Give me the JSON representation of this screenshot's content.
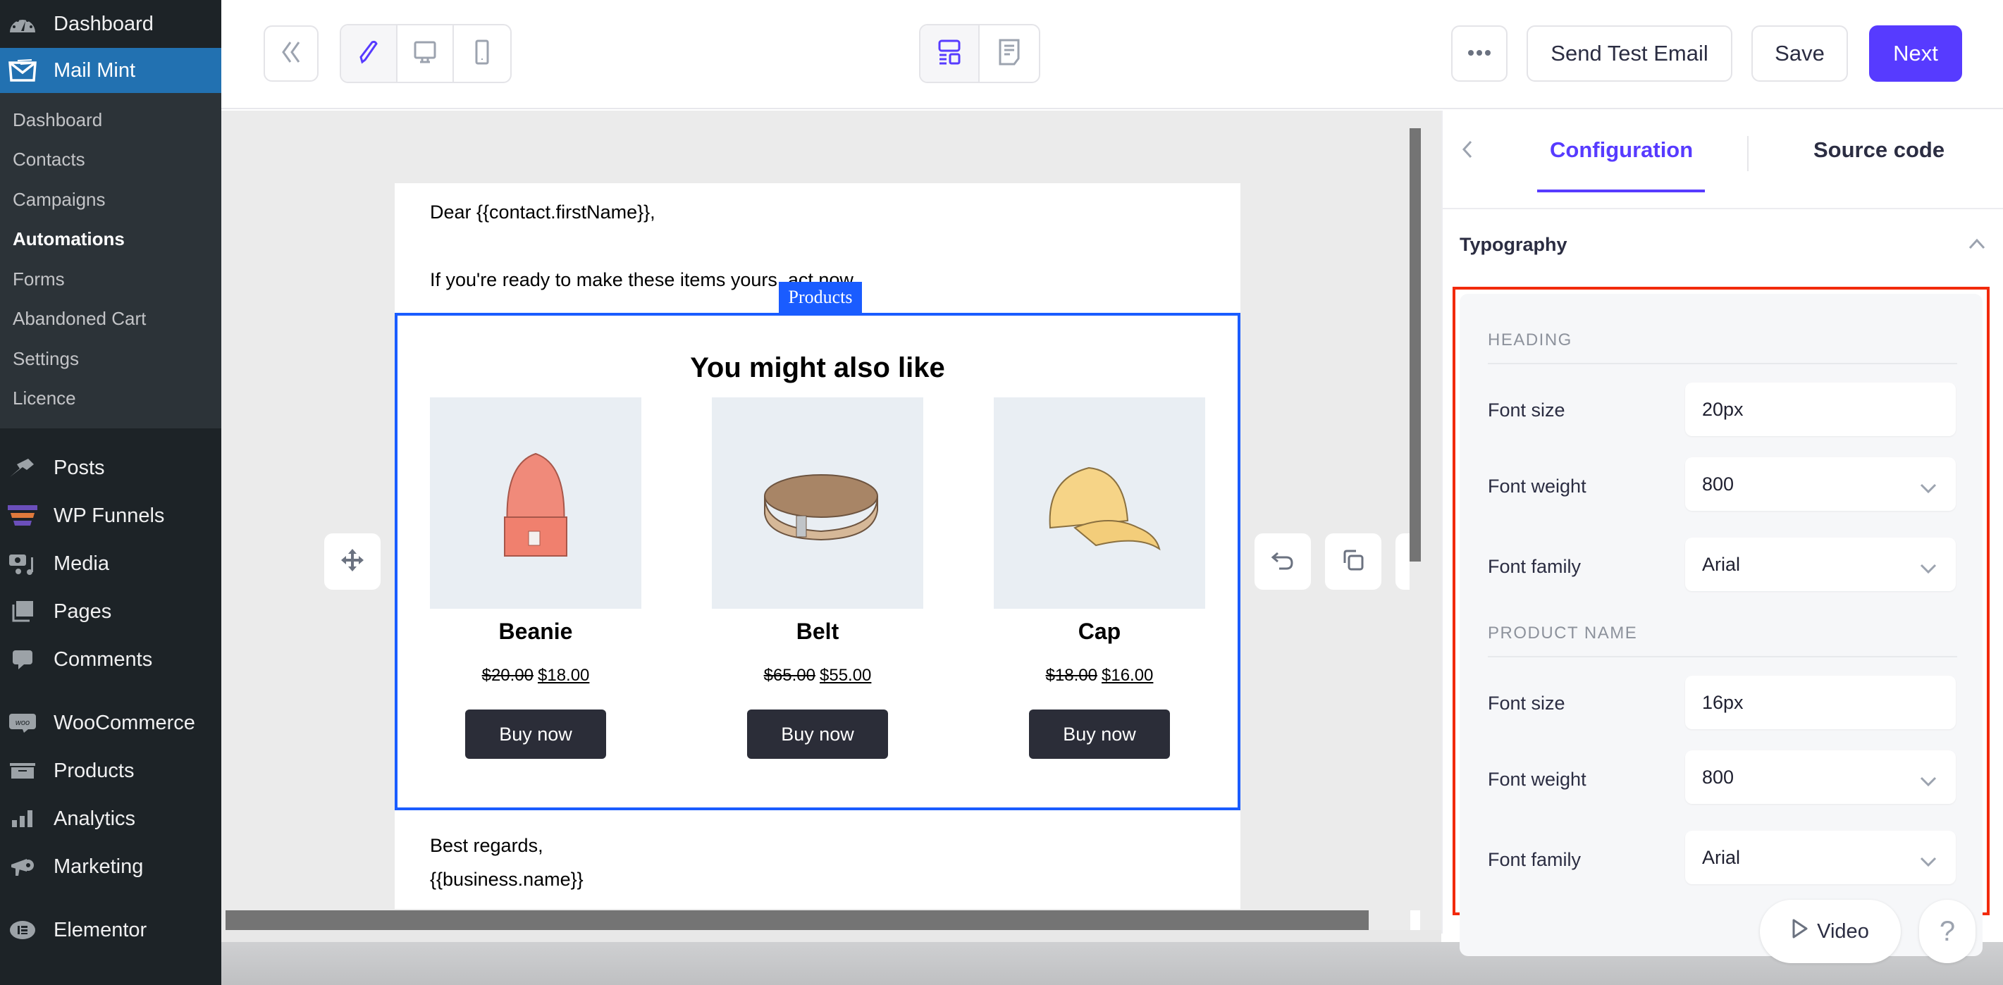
{
  "sidebar": {
    "top_item": {
      "label": "Dashboard",
      "icon": "dashboard-gauge-icon"
    },
    "active_item": {
      "label": "Mail Mint",
      "icon": "mail-mint-envelope-icon"
    },
    "submenu": [
      {
        "label": "Dashboard",
        "active": false
      },
      {
        "label": "Contacts",
        "active": false
      },
      {
        "label": "Campaigns",
        "active": false
      },
      {
        "label": "Automations",
        "active": true
      },
      {
        "label": "Forms",
        "active": false
      },
      {
        "label": "Abandoned Cart",
        "active": false
      },
      {
        "label": "Settings",
        "active": false
      },
      {
        "label": "Licence",
        "active": false
      }
    ],
    "items": [
      {
        "label": "Posts",
        "icon": "pin-icon"
      },
      {
        "label": "WP Funnels",
        "icon": "funnel-icon"
      },
      {
        "label": "Media",
        "icon": "media-icon"
      },
      {
        "label": "Pages",
        "icon": "pages-icon"
      },
      {
        "label": "Comments",
        "icon": "comment-icon"
      },
      {
        "label": "WooCommerce",
        "icon": "woo-icon"
      },
      {
        "label": "Products",
        "icon": "archive-box-icon"
      },
      {
        "label": "Analytics",
        "icon": "bar-chart-icon"
      },
      {
        "label": "Marketing",
        "icon": "megaphone-icon"
      },
      {
        "label": "Elementor",
        "icon": "elementor-icon"
      }
    ],
    "colors": {
      "bg": "#1d2327",
      "submenu_bg": "#2c3338",
      "active": "#2271b1"
    }
  },
  "toolbar": {
    "collapse_icon": "double-chevron-left-icon",
    "view_modes": [
      {
        "name": "edit",
        "icon": "pencil-icon",
        "active": true
      },
      {
        "name": "desktop",
        "icon": "monitor-icon",
        "active": false
      },
      {
        "name": "mobile",
        "icon": "phone-icon",
        "active": false
      }
    ],
    "layout_modes": [
      {
        "name": "blocks",
        "icon": "layout-blocks-icon",
        "active": true
      },
      {
        "name": "document",
        "icon": "document-icon",
        "active": false
      }
    ],
    "more_icon": "ellipsis-icon",
    "send_test_label": "Send Test Email",
    "save_label": "Save",
    "next_label": "Next",
    "accent": "#573bff"
  },
  "email": {
    "greeting": "Dear {{contact.firstName}},",
    "intro": "If you're ready to make these items yours, act now.",
    "block_tag": "Products",
    "heading": "You might also like",
    "products": [
      {
        "name": "Beanie",
        "regular_price": "$20.00",
        "sale_price": "$18.00",
        "button": "Buy now",
        "image": "beanie-image"
      },
      {
        "name": "Belt",
        "regular_price": "$65.00",
        "sale_price": "$55.00",
        "button": "Buy now",
        "image": "belt-image"
      },
      {
        "name": "Cap",
        "regular_price": "$18.00",
        "sale_price": "$16.00",
        "button": "Buy now",
        "image": "cap-image"
      }
    ],
    "closing_line1": "Best regards,",
    "closing_line2": "{{business.name}}"
  },
  "panel": {
    "tabs": [
      {
        "label": "Configuration",
        "active": true
      },
      {
        "label": "Source code",
        "active": false
      }
    ],
    "section_title": "Typography",
    "groups": [
      {
        "label": "HEADING",
        "fields": [
          {
            "label": "Font size",
            "value": "20px",
            "type": "input"
          },
          {
            "label": "Font weight",
            "value": "800",
            "type": "select"
          },
          {
            "label": "Font family",
            "value": "Arial",
            "type": "select"
          }
        ]
      },
      {
        "label": "PRODUCT NAME",
        "fields": [
          {
            "label": "Font size",
            "value": "16px",
            "type": "input"
          },
          {
            "label": "Font weight",
            "value": "800",
            "type": "select"
          },
          {
            "label": "Font family",
            "value": "Arial",
            "type": "select"
          }
        ]
      }
    ],
    "highlight_color": "#f22a0c"
  },
  "floating": {
    "video_label": "Video",
    "help_label": "?"
  }
}
